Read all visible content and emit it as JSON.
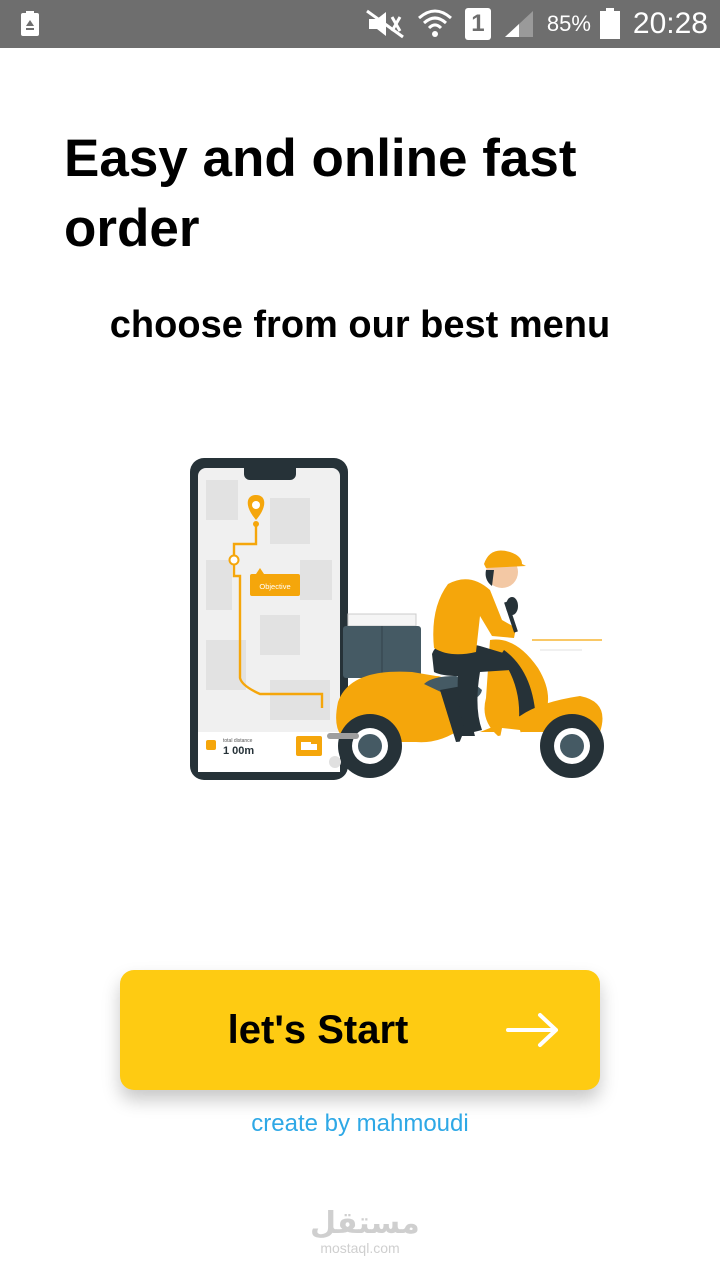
{
  "status_bar": {
    "battery_percent": "85%",
    "time": "20:28",
    "sim_slot": "1",
    "icons": [
      "recycle-icon",
      "mute-icon",
      "wifi-icon",
      "sim-icon",
      "signal-icon",
      "battery-icon"
    ]
  },
  "onboarding": {
    "title": "Easy and online fast order",
    "subtitle": "choose from our best menu",
    "illustration": {
      "map_label": "Objective",
      "distance_caption": "total distance",
      "distance_value": "1 00m"
    },
    "start_button_label": "let's Start",
    "credit": "create by mahmoudi"
  },
  "watermark": {
    "logo": "مستقل",
    "url": "mostaql.com"
  },
  "colors": {
    "accent": "#fecb12",
    "illustration_orange": "#f5a60b",
    "link": "#2ea8e6",
    "status_bar": "#6e6e6e"
  }
}
